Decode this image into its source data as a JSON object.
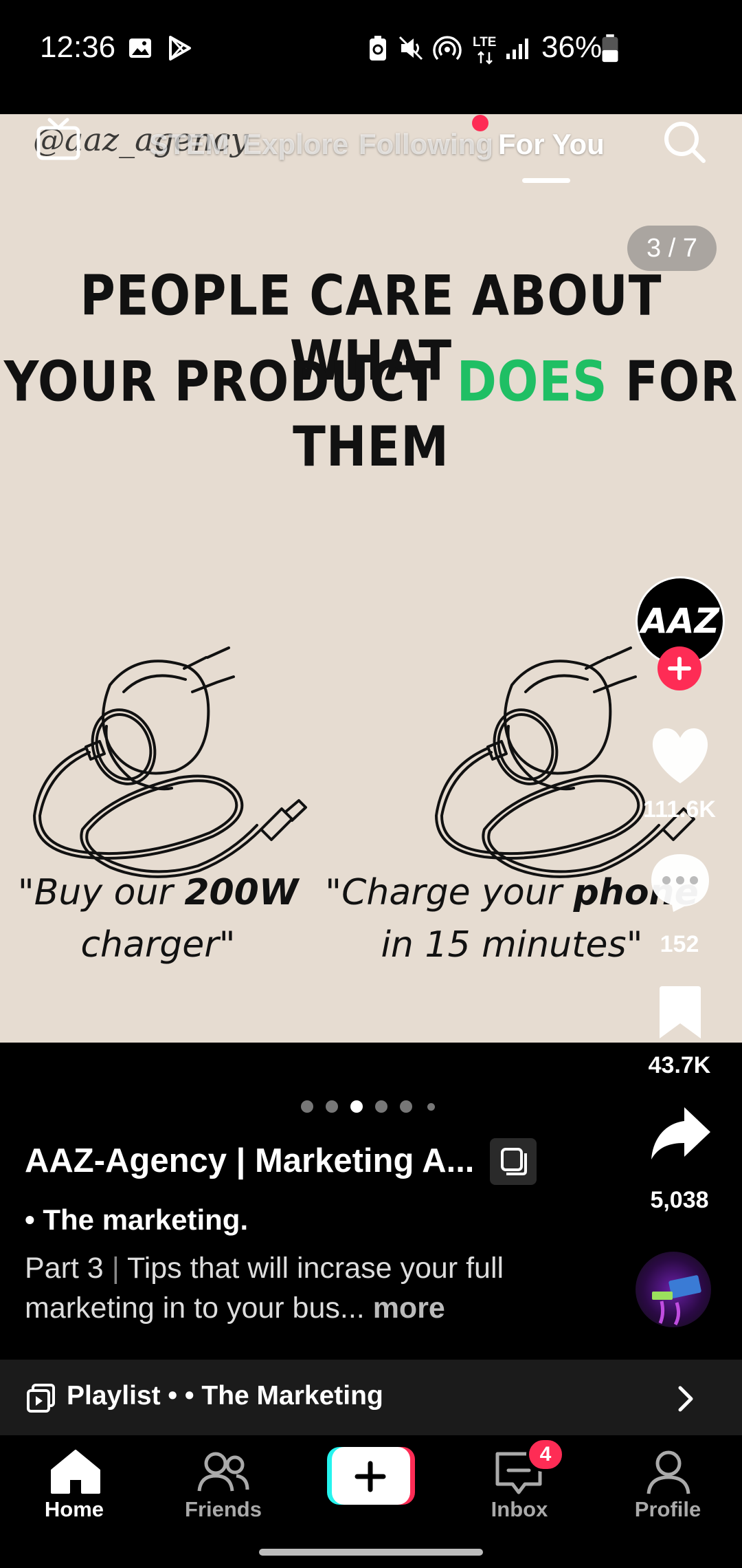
{
  "status_bar": {
    "time": "12:36",
    "battery": "36%",
    "network": "LTE"
  },
  "top_nav": {
    "watermark": "@aaz_agency",
    "tabs": [
      "STEM",
      "Explore",
      "Following",
      "For You"
    ],
    "active_tab": "For You"
  },
  "slide": {
    "counter": "3 / 7",
    "headline_line1": "PEOPLE CARE ABOUT WHAT",
    "headline_line2_a": "YOUR PRODUCT ",
    "headline_line2_highlight": "DOES",
    "headline_line2_b": " FOR THEM",
    "caption_left_a": "\"Buy our ",
    "caption_left_bold": "200W",
    "caption_left_b": "charger\"",
    "caption_right_a": "\"Charge your ",
    "caption_right_bold": "phone",
    "caption_right_b": "in 15 minutes\"",
    "highlight_color": "#1fbf64"
  },
  "right_rail": {
    "avatar_text": "AAZ",
    "likes": "111.6K",
    "comments": "152",
    "saves": "43.7K",
    "shares": "5,038"
  },
  "post": {
    "author": "AAZ-Agency | Marketing A...",
    "subtitle": "• The marketing.",
    "desc_part": "Part 3",
    "desc_sep": "|",
    "desc_text": "Tips that will incrase your full marketing in to your bus...",
    "more": "more",
    "carousel_dots": 6,
    "active_dot": 3
  },
  "playlist": {
    "label": "Playlist • • The Marketing"
  },
  "bottom_nav": {
    "home": "Home",
    "friends": "Friends",
    "inbox": "Inbox",
    "inbox_badge": "4",
    "profile": "Profile"
  },
  "colors": {
    "accent_red": "#fe2c55",
    "slide_bg": "#e6dcd1"
  }
}
